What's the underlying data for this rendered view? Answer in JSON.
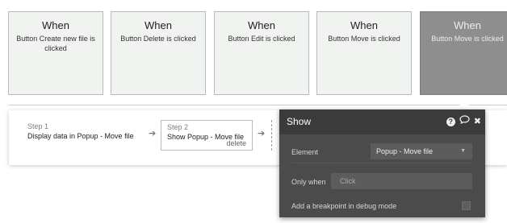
{
  "events": [
    {
      "when": "When",
      "desc": "Button Create new file is clicked",
      "selected": false
    },
    {
      "when": "When",
      "desc": "Button Delete is clicked",
      "selected": false
    },
    {
      "when": "When",
      "desc": "Button Edit is clicked",
      "selected": false
    },
    {
      "when": "When",
      "desc": "Button Move is clicked",
      "selected": false
    },
    {
      "when": "When",
      "desc": "Button Move is clicked",
      "selected": true
    }
  ],
  "workflow": {
    "step1": {
      "num": "Step 1",
      "title": "Display data in Popup - Move file"
    },
    "step2": {
      "num": "Step 2",
      "title": "Show Popup - Move file",
      "delete_label": "delete"
    },
    "arrow": "➔"
  },
  "panel": {
    "title": "Show",
    "icons": [
      "help-icon",
      "comment-icon",
      "close-icon"
    ],
    "element_label": "Element",
    "element_value": "Popup - Move file",
    "only_when_label": "Only when",
    "only_when_placeholder": "Click",
    "breakpoint_label": "Add a breakpoint in debug mode",
    "breakpoint_checked": false
  },
  "colors": {
    "card_bg": "#f1f3f1",
    "card_selected_bg": "#8e8e8e",
    "panel_bg": "#4a4b4a",
    "panel_header_bg": "#3a3b3a"
  }
}
